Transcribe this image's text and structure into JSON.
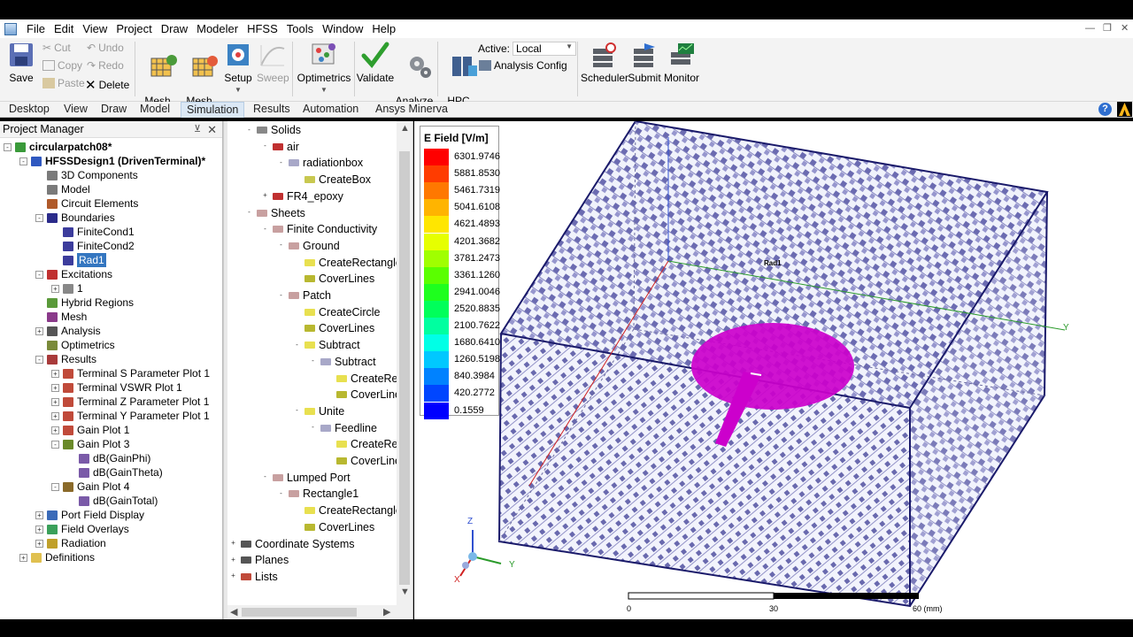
{
  "menu": [
    "File",
    "Edit",
    "View",
    "Project",
    "Draw",
    "Modeler",
    "HFSS",
    "Tools",
    "Window",
    "Help"
  ],
  "ribbon": {
    "save": "Save",
    "cut": "Cut",
    "copy": "Copy",
    "paste": "Paste",
    "undo": "Undo",
    "redo": "Redo",
    "delete": "Delete",
    "mesh_settings": "Mesh\nSettings",
    "mesh_feedback": "Mesh\nFeedback",
    "setup": "Setup",
    "sweep": "Sweep",
    "optimetrics": "Optimetrics",
    "validate": "Validate",
    "analyze_all": "Analyze\nAll",
    "hpc_options": "HPC\nOptions",
    "active_label": "Active:",
    "active_value": "Local",
    "analysis_config": "Analysis Config",
    "scheduler": "Scheduler",
    "submit": "Submit",
    "monitor": "Monitor"
  },
  "tabs": [
    "Desktop",
    "View",
    "Draw",
    "Model",
    "Simulation",
    "Results",
    "Automation",
    "Ansys Minerva"
  ],
  "active_tab": "Simulation",
  "project_manager": {
    "title": "Project Manager",
    "items": [
      {
        "label": "circularpatch08*",
        "bold": true
      },
      {
        "label": "HFSSDesign1 (DrivenTerminal)*",
        "bold": true
      },
      {
        "label": "3D Components"
      },
      {
        "label": "Model"
      },
      {
        "label": "Circuit Elements"
      },
      {
        "label": "Boundaries"
      },
      {
        "label": "FiniteCond1"
      },
      {
        "label": "FiniteCond2"
      },
      {
        "label": "Rad1",
        "selected": true
      },
      {
        "label": "Excitations"
      },
      {
        "label": "1"
      },
      {
        "label": "Hybrid Regions"
      },
      {
        "label": "Mesh"
      },
      {
        "label": "Analysis"
      },
      {
        "label": "Optimetrics"
      },
      {
        "label": "Results"
      },
      {
        "label": "Terminal S Parameter Plot 1"
      },
      {
        "label": "Terminal VSWR Plot 1"
      },
      {
        "label": "Terminal Z Parameter Plot 1"
      },
      {
        "label": "Terminal Y Parameter Plot 1"
      },
      {
        "label": "Gain Plot 1"
      },
      {
        "label": "Gain Plot 3"
      },
      {
        "label": "dB(GainPhi)"
      },
      {
        "label": "dB(GainTheta)"
      },
      {
        "label": "Gain Plot 4"
      },
      {
        "label": "dB(GainTotal)"
      },
      {
        "label": "Port Field Display"
      },
      {
        "label": "Field Overlays"
      },
      {
        "label": "Radiation"
      },
      {
        "label": "Definitions"
      }
    ]
  },
  "model_tree": {
    "items": [
      {
        "label": "Solids"
      },
      {
        "label": "air"
      },
      {
        "label": "radiationbox"
      },
      {
        "label": "CreateBox"
      },
      {
        "label": "FR4_epoxy"
      },
      {
        "label": "Sheets"
      },
      {
        "label": "Finite Conductivity"
      },
      {
        "label": "Ground"
      },
      {
        "label": "CreateRectangle"
      },
      {
        "label": "CoverLines"
      },
      {
        "label": "Patch"
      },
      {
        "label": "CreateCircle"
      },
      {
        "label": "CoverLines"
      },
      {
        "label": "Subtract"
      },
      {
        "label": "Subtract"
      },
      {
        "label": "CreateRec"
      },
      {
        "label": "CoverLine"
      },
      {
        "label": "Unite"
      },
      {
        "label": "Feedline"
      },
      {
        "label": "CreateRec"
      },
      {
        "label": "CoverLine"
      },
      {
        "label": "Lumped Port"
      },
      {
        "label": "Rectangle1"
      },
      {
        "label": "CreateRectangle"
      },
      {
        "label": "CoverLines"
      },
      {
        "label": "Coordinate Systems"
      },
      {
        "label": "Planes"
      },
      {
        "label": "Lists"
      }
    ]
  },
  "legend": {
    "title": "E Field [V/m]",
    "values": [
      "6301.9746",
      "5881.8530",
      "5461.7319",
      "5041.6108",
      "4621.4893",
      "4201.3682",
      "3781.2473",
      "3361.1260",
      "2941.0046",
      "2520.8835",
      "2100.7622",
      "1680.6410",
      "1260.5198",
      "840.3984",
      "420.2772",
      "0.1559"
    ],
    "colors": [
      "#ff0000",
      "#ff3c00",
      "#ff7800",
      "#ffb400",
      "#ffe600",
      "#e6ff00",
      "#a0ff00",
      "#5aff00",
      "#1eff1e",
      "#00ff5a",
      "#00ffa0",
      "#00ffe6",
      "#00c8ff",
      "#0082ff",
      "#0046ff",
      "#0000ff"
    ]
  },
  "viewport": {
    "boundary_label": "Rad1",
    "axis_y": "Y",
    "axis_z": "Z",
    "axis_x": "X",
    "scale_0": "0",
    "scale_30": "30",
    "scale_60": "60 (mm)",
    "field_color": "#cc00cc"
  }
}
